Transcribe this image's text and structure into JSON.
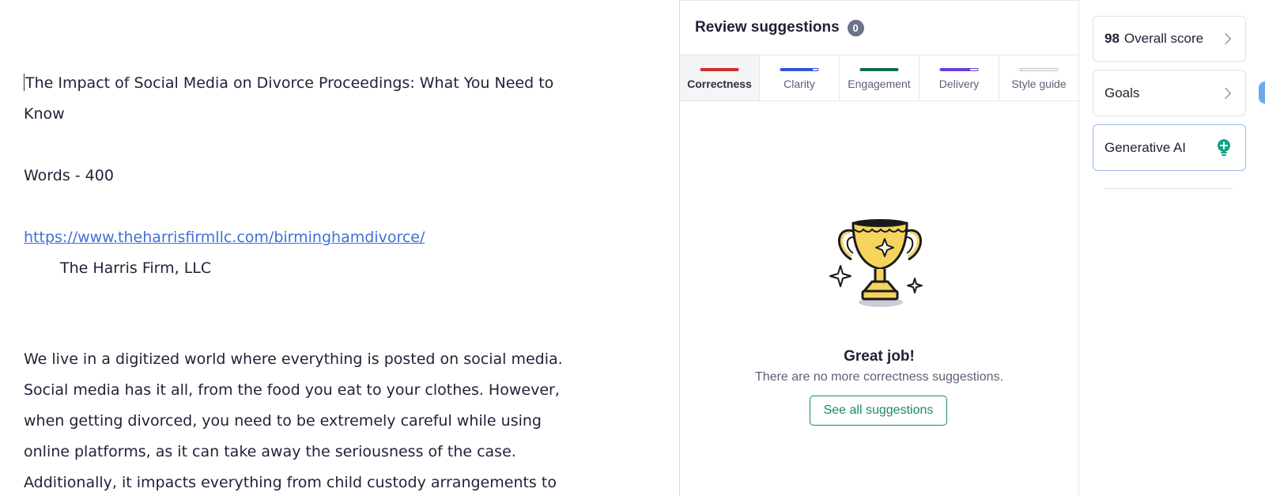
{
  "editor": {
    "title_line1": "The Impact of Social Media on Divorce Proceedings: What You Need to",
    "title_line2": "Know",
    "words": "Words - 400",
    "link": "https://www.theharrisfirmllc.com/birminghamdivorce/",
    "firm": "The Harris Firm, LLC",
    "para_lines": [
      "We live in a digitized world where everything is posted on social media.",
      "Social media has it all, from the food you eat to your clothes. However,",
      "when getting divorced, you need to be extremely careful while using",
      "online platforms, as it can take away the seriousness of the case.",
      "Additionally, it impacts everything from child custody arrangements to"
    ]
  },
  "review": {
    "title": "Review suggestions",
    "count": "0",
    "tabs": [
      {
        "label": "Correctness",
        "color": "#d0312d",
        "active": true
      },
      {
        "label": "Clarity",
        "color": "#2f55d4",
        "active": false
      },
      {
        "label": "Engagement",
        "color": "#0f6b50",
        "active": false
      },
      {
        "label": "Delivery",
        "color": "#6a3fd6",
        "active": false
      },
      {
        "label": "Style guide",
        "color": "#c9ccd4",
        "active": false
      }
    ],
    "empty_title": "Great job!",
    "empty_text": "There are no more correctness suggestions.",
    "see_all": "See all suggestions"
  },
  "sidebar": {
    "score_value": "98",
    "score_label": "Overall score",
    "goals": "Goals",
    "gen_ai": "Generative AI"
  },
  "colors": {
    "accent_green": "#1b8a6b",
    "link_blue": "#3f6fd8",
    "trophy_gold": "#f5d35c"
  }
}
